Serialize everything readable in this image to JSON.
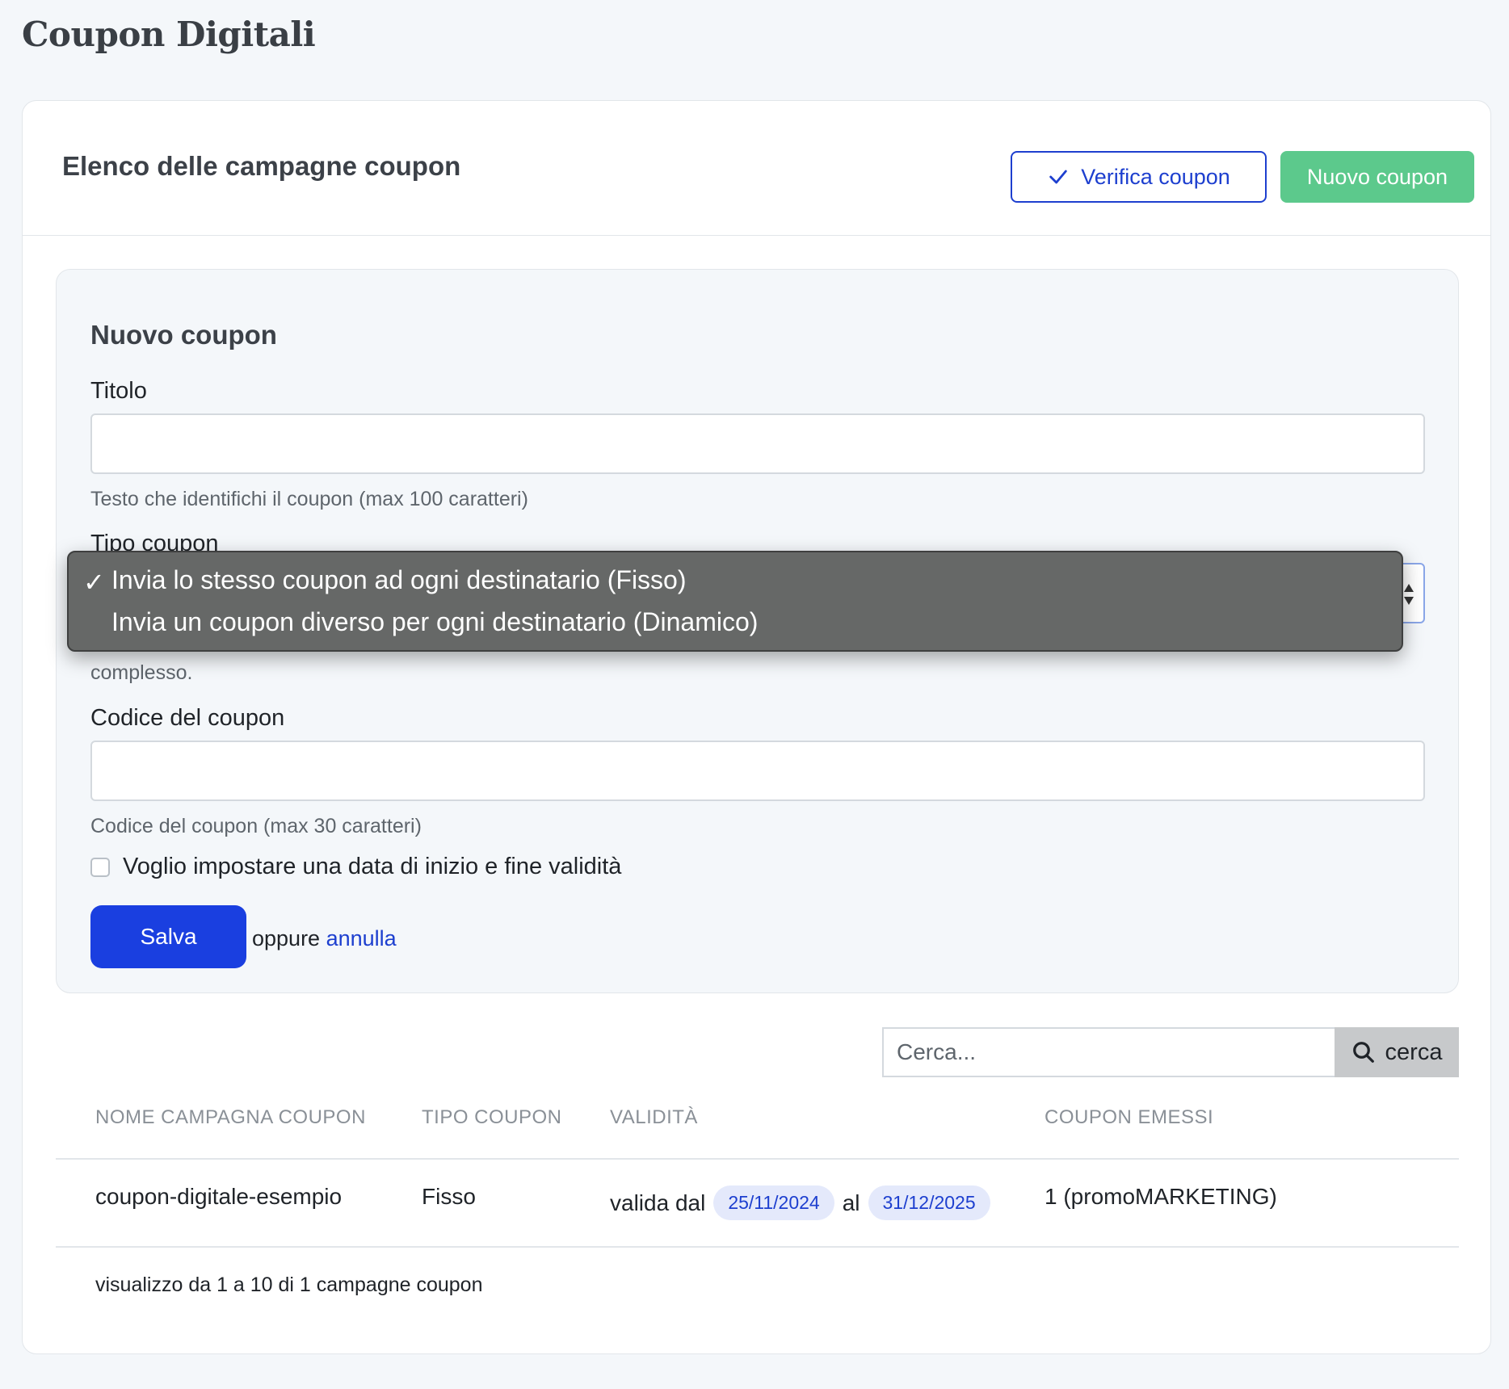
{
  "page": {
    "title": "Coupon Digitali"
  },
  "card": {
    "title": "Elenco delle campagne coupon",
    "verify_label": "Verifica coupon",
    "new_label": "Nuovo coupon"
  },
  "form": {
    "title": "Nuovo coupon",
    "titolo_label": "Titolo",
    "titolo_value": "",
    "titolo_help": "Testo che identifichi il coupon (max 100 caratteri)",
    "tipo_label": "Tipo coupon",
    "tipo_help_tail": "complesso.",
    "codice_label": "Codice del coupon",
    "codice_value": "",
    "codice_help": "Codice del coupon (max 30 caratteri)",
    "validity_checkbox_label": "Voglio impostare una data di inizio e fine validità",
    "save_label": "Salva",
    "or_label": "oppure",
    "cancel_label": "annulla"
  },
  "dropdown": {
    "selected_index": 0,
    "options": [
      "Invia lo stesso coupon ad ogni destinatario (Fisso)",
      "Invia un coupon diverso per ogni destinatario (Dinamico)"
    ],
    "check_mark": "✓"
  },
  "search": {
    "placeholder": "Cerca...",
    "button_label": "cerca"
  },
  "table": {
    "headers": [
      "NOME CAMPAGNA COUPON",
      "TIPO COUPON",
      "VALIDITÀ",
      "COUPON EMESSI"
    ],
    "rows": [
      {
        "name": "coupon-digitale-esempio",
        "type": "Fisso",
        "valid_from_label": "valida dal",
        "valid_from": "25/11/2024",
        "valid_to_label": "al",
        "valid_to": "31/12/2025",
        "issued": "1 (promoMARKETING)"
      }
    ],
    "footer": "visualizzo da 1 a 10 di 1 campagne coupon"
  },
  "colors": {
    "primary": "#1a3fe0",
    "success": "#5cc98c",
    "badge_bg": "#e4e9fb"
  }
}
